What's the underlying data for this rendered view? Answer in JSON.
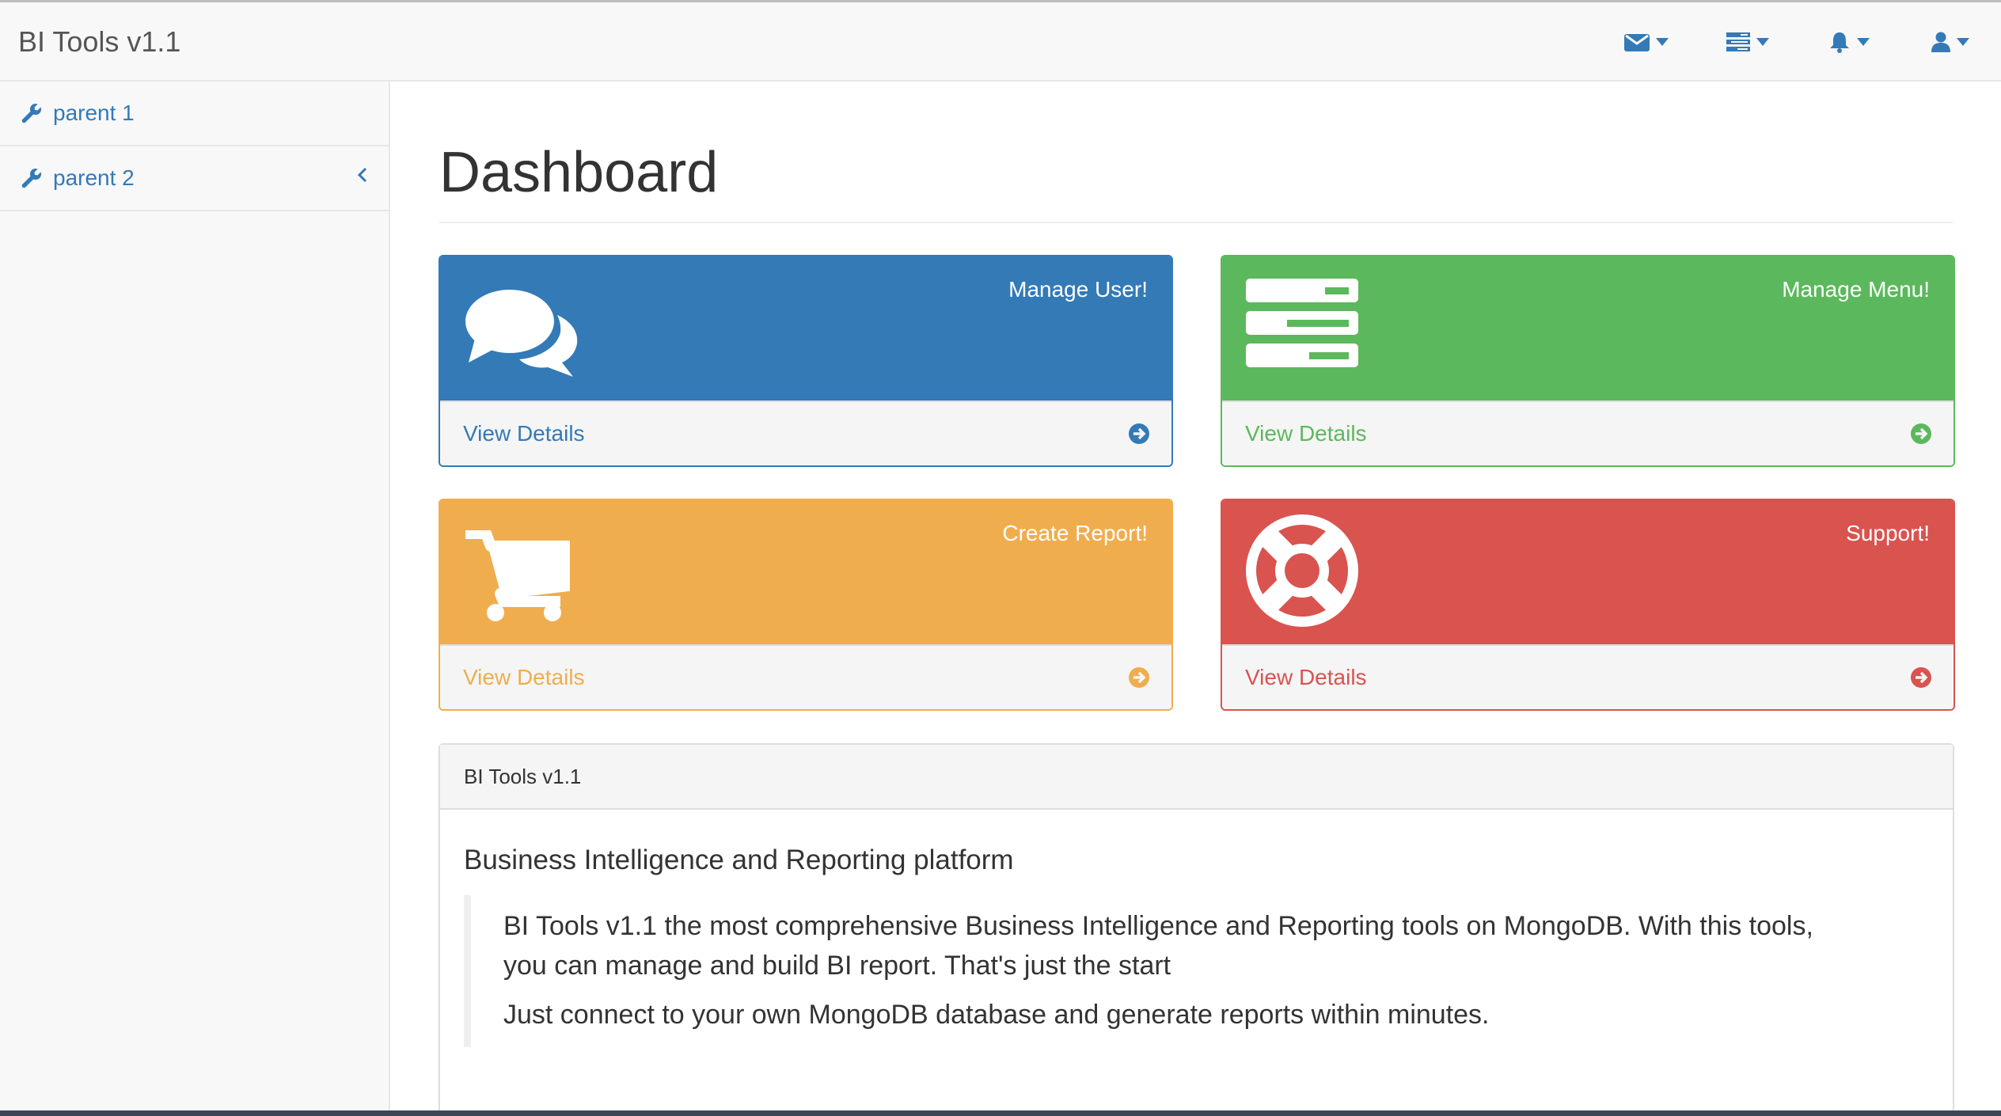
{
  "navbar": {
    "brand": "BI Tools v1.1",
    "icons": [
      "envelope-icon",
      "tasks-icon",
      "bell-icon",
      "user-icon"
    ]
  },
  "sidebar": {
    "items": [
      {
        "label": "parent 1",
        "icon": "wrench-icon"
      },
      {
        "label": "parent 2",
        "icon": "wrench-icon",
        "expander": "chevron-left-icon"
      }
    ]
  },
  "main": {
    "title": "Dashboard",
    "panels": [
      {
        "title": "Manage User!",
        "link": "View Details",
        "icon": "comments-icon",
        "color": "#337ab7"
      },
      {
        "title": "Manage Menu!",
        "link": "View Details",
        "icon": "tasks-icon",
        "color": "#5cb85c"
      },
      {
        "title": "Create Report!",
        "link": "View Details",
        "icon": "shopping-cart-icon",
        "color": "#f0ad4e"
      },
      {
        "title": "Support!",
        "link": "View Details",
        "icon": "life-ring-icon",
        "color": "#d9534f"
      }
    ],
    "info": {
      "heading": "BI Tools v1.1",
      "subheading": "Business Intelligence and Reporting platform",
      "line1": "BI Tools v1.1 the most comprehensive Business Intelligence and Reporting tools on MongoDB. With this tools,",
      "line2": "you can manage and build BI report. That's just the start",
      "line3": "Just connect to your own MongoDB database and generate reports within minutes."
    }
  }
}
